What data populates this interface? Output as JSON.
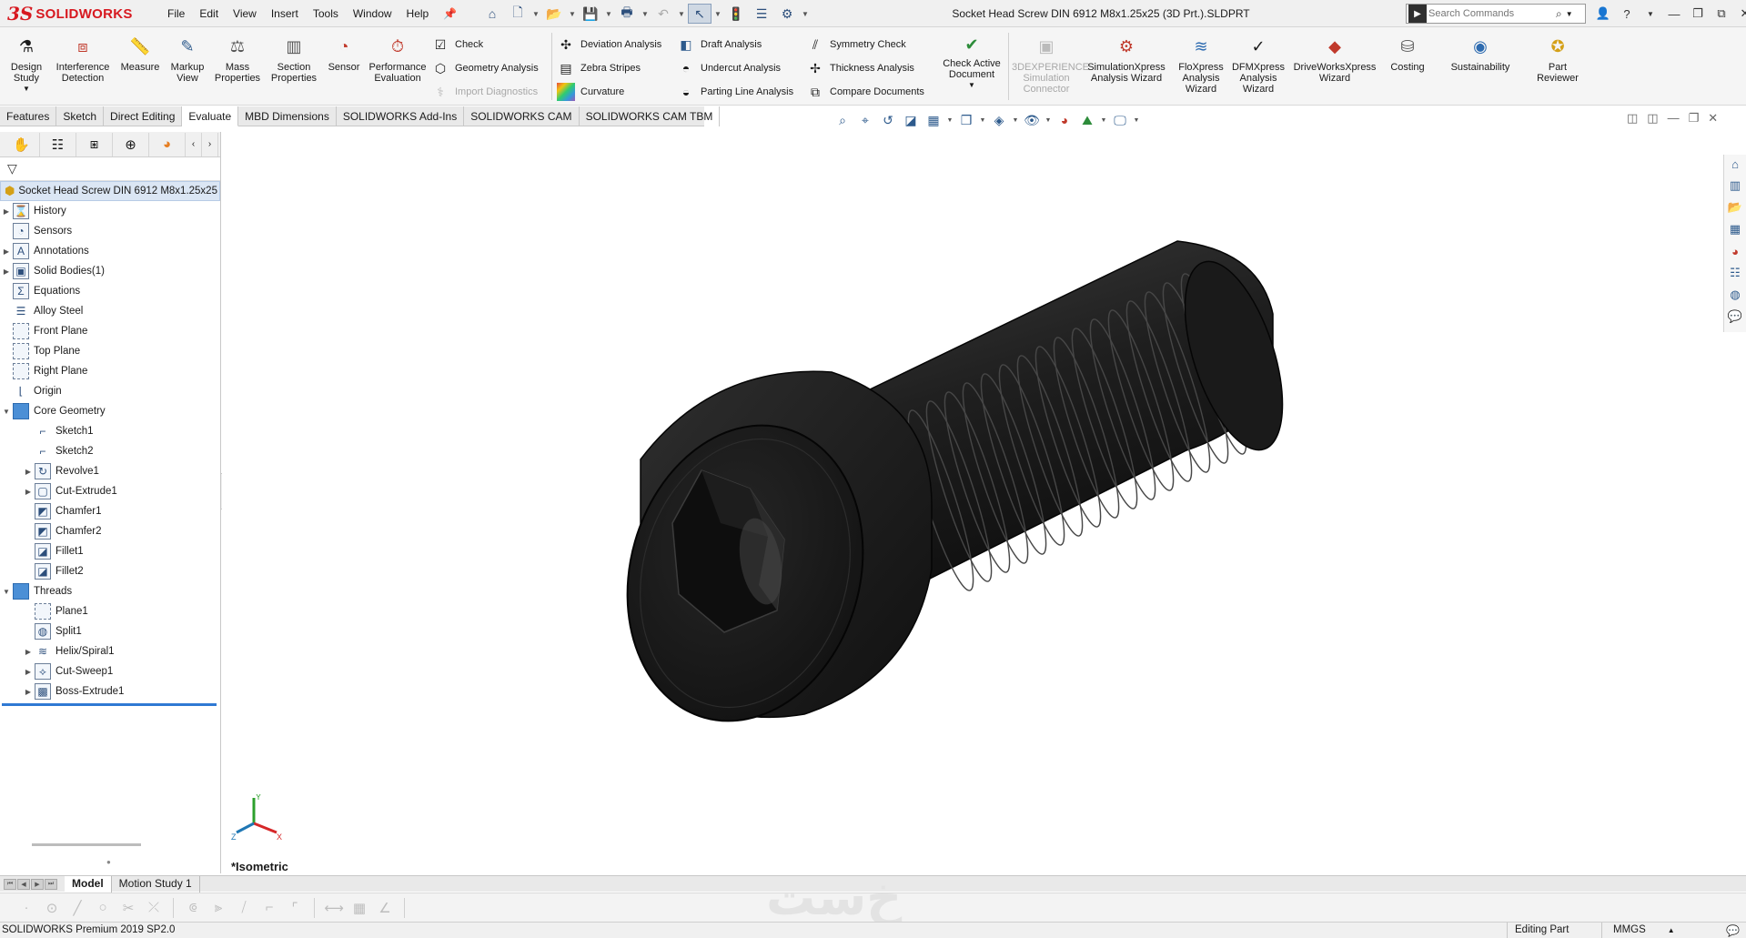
{
  "app": {
    "logo_mark": "3S",
    "logo_text": "SOLIDWORKS",
    "document_title": "Socket Head Screw DIN 6912 M8x1.25x25 (3D Prt.).SLDPRT",
    "menu": [
      "File",
      "Edit",
      "View",
      "Insert",
      "Tools",
      "Window",
      "Help"
    ],
    "search_placeholder": "Search Commands"
  },
  "evaluate_toolbar": {
    "design_study": "Design Study",
    "interference_detection": "Interference Detection",
    "measure": "Measure",
    "markup_view": "Markup View",
    "mass_properties": "Mass Properties",
    "section_properties": "Section Properties",
    "sensor": "Sensor",
    "performance_evaluation": "Performance Evaluation",
    "check": "Check",
    "geometry_analysis": "Geometry Analysis",
    "import_diagnostics": "Import Diagnostics",
    "deviation_analysis": "Deviation Analysis",
    "zebra_stripes": "Zebra Stripes",
    "curvature": "Curvature",
    "draft_analysis": "Draft Analysis",
    "undercut_analysis": "Undercut Analysis",
    "parting_line_analysis": "Parting Line Analysis",
    "symmetry_check": "Symmetry Check",
    "thickness_analysis": "Thickness Analysis",
    "compare_documents": "Compare Documents",
    "check_active_document": "Check Active Document",
    "experience_connector": "3DEXPERIENCE Simulation Connector",
    "simulationxpress": "SimulationXpress Analysis Wizard",
    "floxpress": "FloXpress Analysis Wizard",
    "dfmxpress": "DFMXpress Analysis Wizard",
    "driveworksxpress": "DriveWorksXpress Wizard",
    "costing": "Costing",
    "sustainability": "Sustainability",
    "part_reviewer": "Part Reviewer"
  },
  "tabs": [
    "Features",
    "Sketch",
    "Direct Editing",
    "Evaluate",
    "MBD Dimensions",
    "SOLIDWORKS Add-Ins",
    "SOLIDWORKS CAM",
    "SOLIDWORKS CAM TBM"
  ],
  "active_tab": "Evaluate",
  "feature_tree": {
    "root": "Socket Head Screw DIN 6912 M8x1.25x25",
    "items": [
      {
        "label": "History"
      },
      {
        "label": "Sensors"
      },
      {
        "label": "Annotations"
      },
      {
        "label": "Solid Bodies(1)"
      },
      {
        "label": "Equations"
      },
      {
        "label": "Alloy Steel"
      },
      {
        "label": "Front Plane"
      },
      {
        "label": "Top Plane"
      },
      {
        "label": "Right Plane"
      },
      {
        "label": "Origin"
      },
      {
        "label": "Core Geometry"
      },
      {
        "label": "Sketch1"
      },
      {
        "label": "Sketch2"
      },
      {
        "label": "Revolve1"
      },
      {
        "label": "Cut-Extrude1"
      },
      {
        "label": "Chamfer1"
      },
      {
        "label": "Chamfer2"
      },
      {
        "label": "Fillet1"
      },
      {
        "label": "Fillet2"
      },
      {
        "label": "Threads"
      },
      {
        "label": "Plane1"
      },
      {
        "label": "Split1"
      },
      {
        "label": "Helix/Spiral1"
      },
      {
        "label": "Cut-Sweep1"
      },
      {
        "label": "Boss-Extrude1"
      }
    ]
  },
  "viewport": {
    "view_name": "*Isometric",
    "model_color": "#1c1c1c"
  },
  "bottom_tabs": [
    "Model",
    "Motion Study 1"
  ],
  "watermark": "خ‌ست",
  "status": {
    "product": "SOLIDWORKS Premium 2019 SP2.0",
    "mode": "Editing Part",
    "units": "MMGS"
  }
}
